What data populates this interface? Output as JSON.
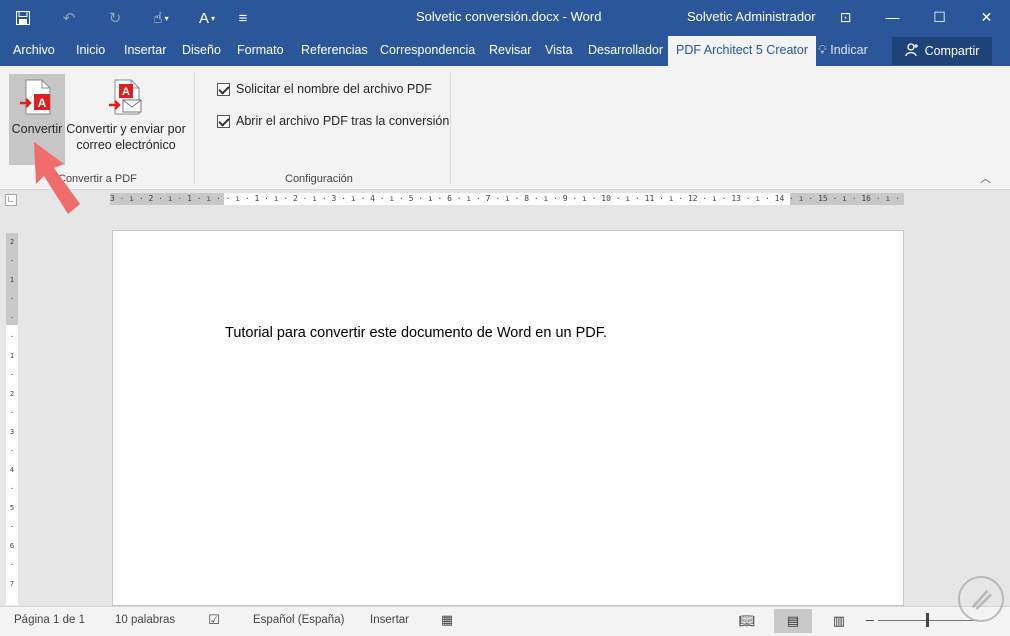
{
  "title_bar": {
    "document_title": "Solvetic conversión.docx - Word",
    "user_name": "Solvetic Administrador"
  },
  "tabs": [
    {
      "label": "Archivo",
      "active": false
    },
    {
      "label": "Inicio",
      "active": false
    },
    {
      "label": "Insertar",
      "active": false
    },
    {
      "label": "Diseño",
      "active": false
    },
    {
      "label": "Formato",
      "active": false
    },
    {
      "label": "Referencias",
      "active": false
    },
    {
      "label": "Correspondencia",
      "active": false
    },
    {
      "label": "Revisar",
      "active": false
    },
    {
      "label": "Vista",
      "active": false
    },
    {
      "label": "Desarrollador",
      "active": false
    },
    {
      "label": "PDF Architect 5 Creator",
      "active": true
    }
  ],
  "tell_me": "Indicar",
  "share_label": "Compartir",
  "ribbon": {
    "convertir_label": "Convertir",
    "enviar_label_1": "Convertir y enviar por",
    "enviar_label_2": "correo electrónico",
    "group_convertir": "Convertir a PDF",
    "option_1": "Solicitar el nombre del archivo PDF",
    "option_2": "Abrir el archivo PDF tras la conversión",
    "group_config": "Configuración"
  },
  "ruler": {
    "horizontal": "3 · ı · 2 · ı · 1 · ı ·   · ı · 1 · ı · 2 · ı · 3 · ı · 4 · ı · 5 · ı · 6 · ı · 7 · ı · 8 · ı · 9 · ı · 10 · ı · 11 · ı · 12 · ı · 13 · ı · 14 · ı · 15 · ı · 16 · ı · 17 · ı ·",
    "vertical": [
      "2",
      "·",
      "1",
      "·",
      "·",
      "·",
      "1",
      "·",
      "2",
      "·",
      "3",
      "·",
      "4",
      "·",
      "5",
      "·",
      "6",
      "·",
      "7"
    ]
  },
  "document": {
    "body_text": "Tutorial para convertir este documento de Word en un PDF."
  },
  "status_bar": {
    "page": "Página 1 de 1",
    "words": "10 palabras",
    "language": "Español (España)",
    "mode": "Insertar"
  },
  "colors": {
    "word_blue": "#2b579a",
    "ribbon_bg": "#f3f3f3",
    "pressed": "#c6c6c6",
    "arrow": "#f06b6b"
  }
}
